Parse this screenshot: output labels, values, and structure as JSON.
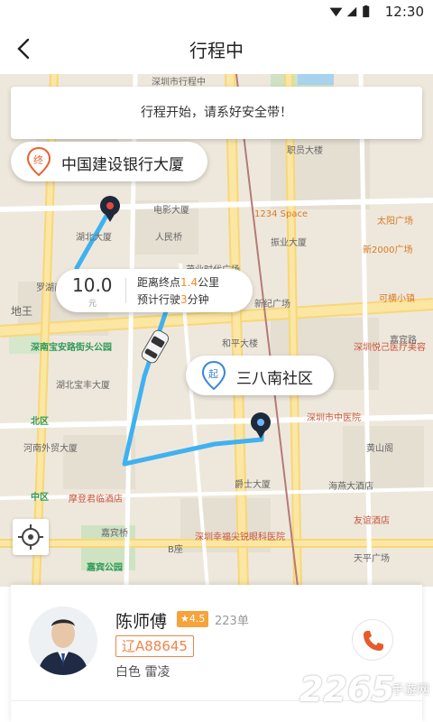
{
  "status_bar": {
    "time": "12:30"
  },
  "nav": {
    "title": "行程中"
  },
  "notice": {
    "text": "行程开始，请系好安全带！"
  },
  "destination": {
    "badge": "终",
    "name": "中国建设银行大厦"
  },
  "origin": {
    "badge": "起",
    "name": "三八南社区"
  },
  "trip_tip": {
    "fare": "10.0",
    "fare_unit": "元",
    "distance_prefix": "距离终点",
    "distance_value": "1.4",
    "distance_unit": "公里",
    "time_prefix": "预计行驶",
    "time_value": "3",
    "time_unit": "分钟"
  },
  "map_labels": [
    "深圳市行程中",
    "职员大楼",
    "电影大厦",
    "1234 Space",
    "太阳广场",
    "湖北大厦",
    "人民桥",
    "振业大厦",
    "新2000广场",
    "茂业时代广场",
    "罗湖商业大厦",
    "新纪广场",
    "可横小镇",
    "地王",
    "深南宝安路街头公园",
    "和平大楼",
    "深圳悦己医疗美容",
    "湖北宝丰大厦",
    "深圳市中医院",
    "北区",
    "黄山阁",
    "河南外贸大厦",
    "爵士大厦",
    "海燕大酒店",
    "中区",
    "摩登君临酒店",
    "嘉宾桥",
    "B座",
    "友谊酒店",
    "深圳幸福尖锐眼科医院",
    "嘉宾公园",
    "天平广场",
    "嘉宾路"
  ],
  "driver": {
    "name": "陈师傅",
    "rating": "★4.5",
    "orders": "223单",
    "plate": "辽A88645",
    "car": "白色 雷凌"
  },
  "watermark": {
    "brand": "2265",
    "site": "手游网"
  },
  "colors": {
    "accent": "#f08a30",
    "route": "#3fb1f0",
    "pin": "#1e2a3a",
    "call": "#e65b2c"
  }
}
